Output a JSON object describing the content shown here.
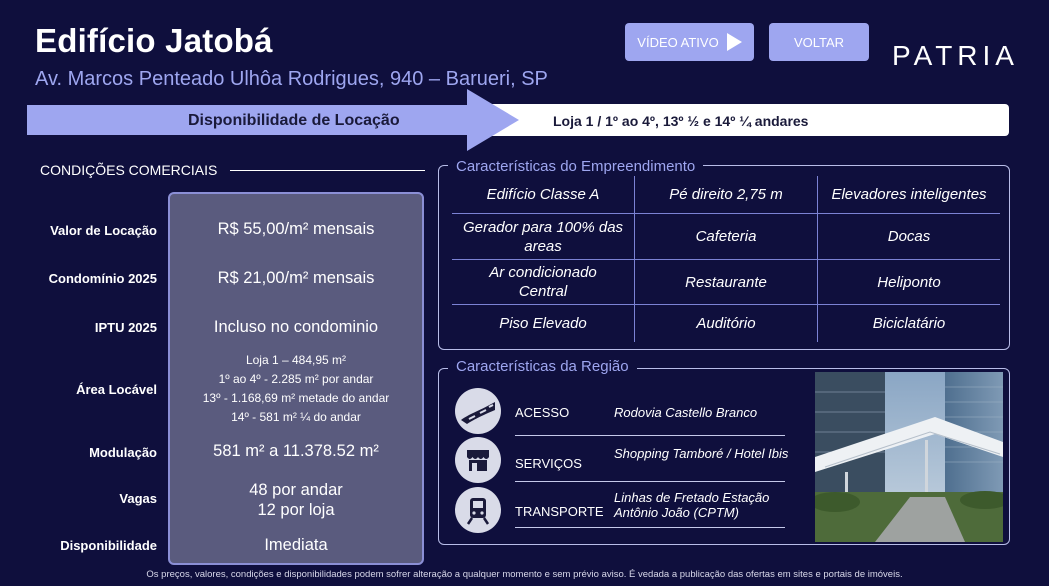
{
  "header": {
    "title": "Edifício Jatobá",
    "address": "Av. Marcos Penteado Ulhôa Rodrigues, 940 – Barueri, SP",
    "video_button_label": "VÍDEO ATIVO",
    "back_button_label": "VOLTAR",
    "logo": "PATRIA"
  },
  "banner": {
    "left_label": "Disponibilidade de Locação",
    "right_label": "Loja 1 / 1º ao 4º, 13º ½  e 14º ¼  andares"
  },
  "conditions": {
    "heading": "CONDIÇÕES COMERCIAIS",
    "rows": [
      {
        "label": "Valor de Locação",
        "value": "R$  55,00/m² mensais"
      },
      {
        "label": "Condomínio 2025",
        "value": "R$ 21,00/m² mensais"
      },
      {
        "label": "IPTU 2025",
        "value": "Incluso no condominio"
      },
      {
        "label": "Área Locável",
        "value_lines": [
          "Loja 1 – 484,95 m²",
          "1º ao 4º - 2.285 m² por andar",
          "13º - 1.168,69 m² metade do andar",
          "14º - 581 m² ¼ do andar"
        ]
      },
      {
        "label": "Modulação",
        "value": "581 m² a  11.378.52  m²"
      },
      {
        "label": "Vagas",
        "value_lines": [
          "48 por andar",
          "12 por loja"
        ]
      },
      {
        "label": "Disponibilidade",
        "value": "Imediata"
      }
    ]
  },
  "empreendimento": {
    "title": "Características do Empreendimento",
    "cells": [
      [
        "Edifício Classe A",
        "Pé direito 2,75 m",
        "Elevadores inteligentes"
      ],
      [
        "Gerador para 100% das areas",
        "Cafeteria",
        "Docas"
      ],
      [
        "Ar condicionado Central",
        "Restaurante",
        "Heliponto"
      ],
      [
        "Piso Elevado",
        "Auditório",
        "Biciclatário"
      ]
    ]
  },
  "regiao": {
    "title": "Características da Região",
    "items": [
      {
        "label": "ACESSO",
        "value": "Rodovia Castello Branco",
        "icon": "road-icon"
      },
      {
        "label": "SERVIÇOS",
        "value": "Shopping Tamboré / Hotel Ibis",
        "icon": "store-icon"
      },
      {
        "label": "TRANSPORTE",
        "value": "Linhas de Fretado Estação Antônio João (CPTM)",
        "icon": "train-icon"
      }
    ]
  },
  "footer": "Os preços, valores, condições e disponibilidades podem sofrer alteração a qualquer momento e sem prévio aviso. É vedada a publicação das ofertas em sites e portais de imóveis."
}
